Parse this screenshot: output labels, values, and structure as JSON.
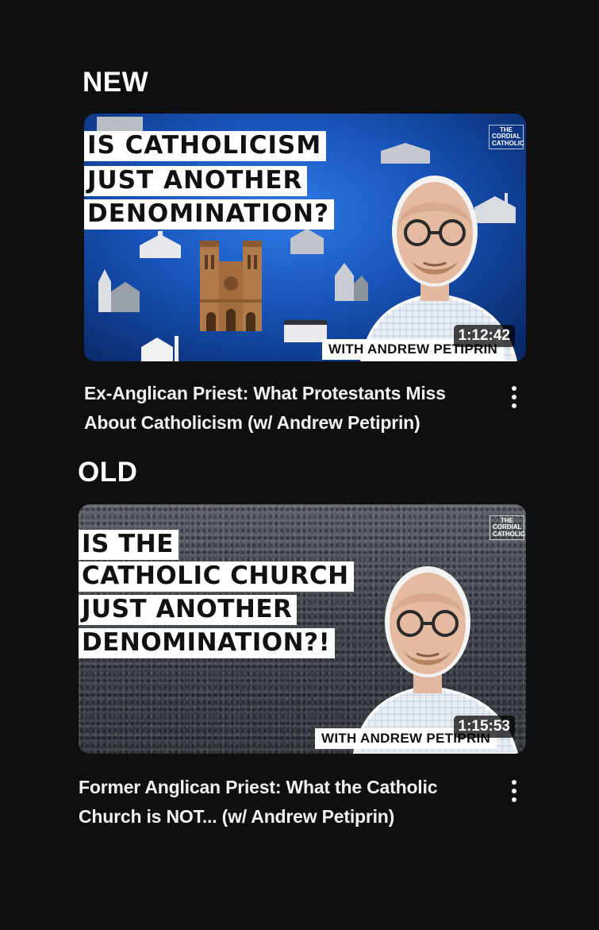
{
  "sections": [
    {
      "label": "NEW",
      "thumbnail": {
        "headline": [
          "IS CATHOLICISM",
          "JUST ANOTHER",
          "DENOMINATION?"
        ],
        "credit": "WITH ANDREW PETIPRIN",
        "duration": "1:12:42",
        "logo": [
          "THE",
          "CORDIAL",
          "CATHOLIC"
        ]
      },
      "title_lines": [
        "Ex-Anglican Priest: What Protestants Miss",
        "About Catholicism (w/ Andrew Petiprin)"
      ]
    },
    {
      "label": "OLD",
      "thumbnail": {
        "headline": [
          "IS THE",
          "CATHOLIC CHURCH",
          "JUST ANOTHER",
          "DENOMINATION?!"
        ],
        "credit": "WITH ANDREW PETIPRIN",
        "duration": "1:15:53",
        "logo": [
          "THE",
          "CORDIAL",
          "CATHOLIC"
        ]
      },
      "title_lines": [
        "Former Anglican Priest: What the Catholic",
        "Church is NOT... (w/ Andrew Petiprin)"
      ]
    }
  ],
  "colors": {
    "background": "#0f0f0f",
    "new_thumb_blue": "#1753b8",
    "text": "#f1f1f1"
  },
  "icons": {
    "more": "more-vert-icon"
  }
}
